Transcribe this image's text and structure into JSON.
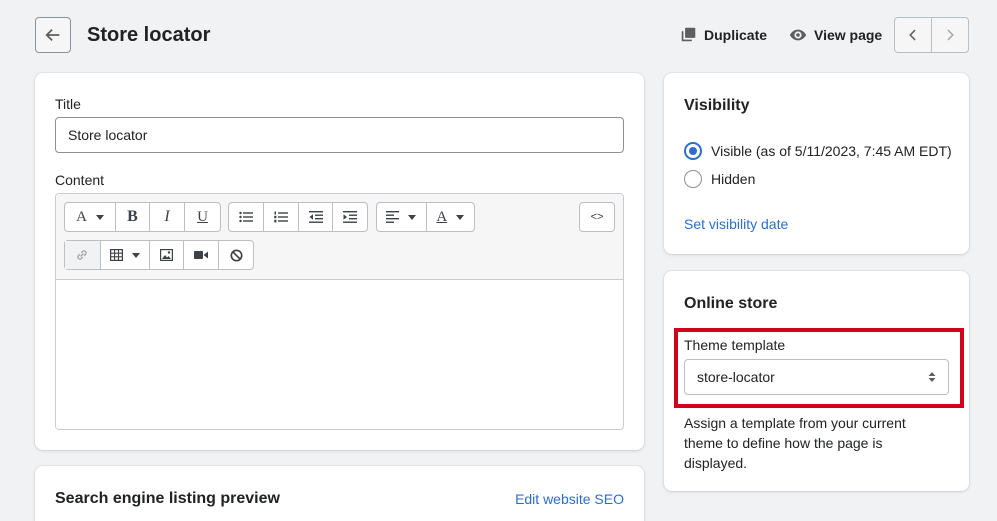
{
  "header": {
    "title": "Store locator",
    "duplicate_label": "Duplicate",
    "view_page_label": "View page"
  },
  "main": {
    "title_label": "Title",
    "title_value": "Store locator",
    "content_label": "Content",
    "toolbar": {
      "font_letter": "A",
      "bold": "B",
      "italic": "I",
      "underline": "U",
      "color_letter": "A",
      "html_label": "<>"
    }
  },
  "seo": {
    "title": "Search engine listing preview",
    "edit_label": "Edit website SEO"
  },
  "visibility": {
    "title": "Visibility",
    "visible_label": "Visible (as of 5/11/2023, 7:45 AM EDT)",
    "hidden_label": "Hidden",
    "set_date_label": "Set visibility date",
    "selected": "visible"
  },
  "online_store": {
    "title": "Online store",
    "template_label": "Theme template",
    "template_value": "store-locator",
    "help_text": "Assign a template from your current theme to define how the page is displayed."
  },
  "colors": {
    "accent": "#2c6ecb",
    "highlight": "#d0021b",
    "background": "#f1f2f3"
  }
}
